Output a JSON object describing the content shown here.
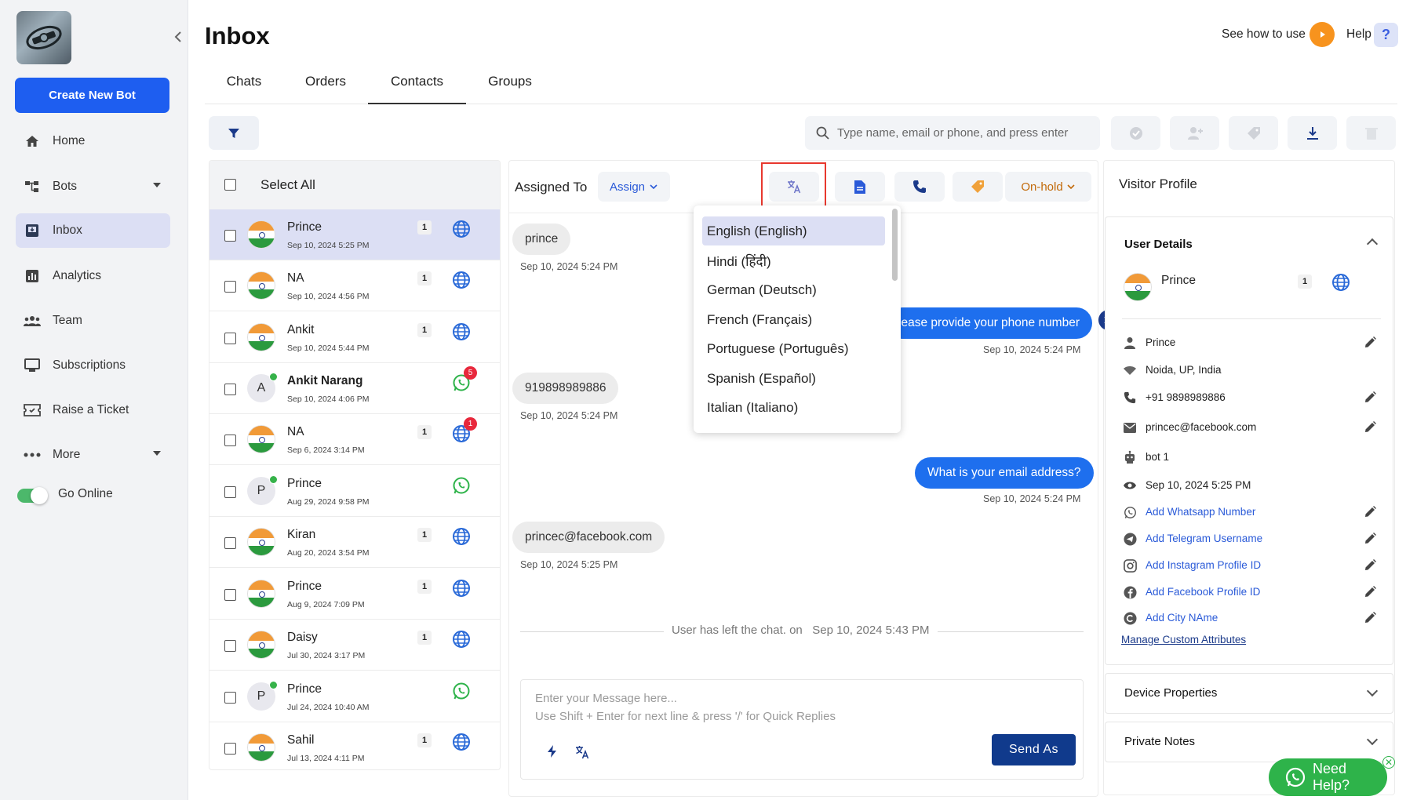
{
  "sidebar": {
    "create_button": "Create New Bot",
    "items": [
      {
        "label": "Home",
        "icon": "home-icon"
      },
      {
        "label": "Bots",
        "icon": "bots-icon"
      },
      {
        "label": "Inbox",
        "icon": "inbox-icon"
      },
      {
        "label": "Analytics",
        "icon": "analytics-icon"
      },
      {
        "label": "Team",
        "icon": "team-icon"
      },
      {
        "label": "Subscriptions",
        "icon": "subscriptions-icon"
      },
      {
        "label": "Raise a Ticket",
        "icon": "ticket-icon"
      },
      {
        "label": "More",
        "icon": "more-icon"
      }
    ],
    "go_online": "Go Online"
  },
  "header": {
    "title": "Inbox",
    "see_how": "See how to use",
    "help": "Help",
    "help_icon": "?"
  },
  "tabs": [
    "Chats",
    "Orders",
    "Contacts",
    "Groups"
  ],
  "toolbar": {
    "search_placeholder": "Type name, email or phone, and press enter"
  },
  "contact_list": {
    "select_all": "Select All",
    "contacts": [
      {
        "name": "Prince",
        "date": "Sep 10, 2024 5:25 PM",
        "count": "1",
        "channel": "web"
      },
      {
        "name": "NA",
        "date": "Sep 10, 2024 4:56 PM",
        "count": "1",
        "channel": "web"
      },
      {
        "name": "Ankit",
        "date": "Sep 10, 2024 5:44 PM",
        "count": "1",
        "channel": "web"
      },
      {
        "name": "Ankit Narang",
        "date": "Sep 10, 2024 4:06 PM",
        "initial": "A",
        "channel": "whatsapp",
        "unread": "5"
      },
      {
        "name": "NA",
        "date": "Sep 6, 2024 3:14 PM",
        "count": "1",
        "channel": "web",
        "unread": "1"
      },
      {
        "name": "Prince",
        "date": "Aug 29, 2024 9:58 PM",
        "initial": "P",
        "channel": "whatsapp"
      },
      {
        "name": "Kiran",
        "date": "Aug 20, 2024 3:54 PM",
        "count": "1",
        "channel": "web"
      },
      {
        "name": "Prince",
        "date": "Aug 9, 2024 7:09 PM",
        "count": "1",
        "channel": "web"
      },
      {
        "name": "Daisy",
        "date": "Jul 30, 2024 3:17 PM",
        "count": "1",
        "channel": "web"
      },
      {
        "name": "Prince",
        "date": "Jul 24, 2024 10:40 AM",
        "initial": "P",
        "channel": "whatsapp"
      },
      {
        "name": "Sahil",
        "date": "Jul 13, 2024 4:11 PM",
        "count": "1",
        "channel": "web"
      }
    ]
  },
  "chat": {
    "assigned_to": "Assigned To",
    "assign": "Assign",
    "status": "On-hold",
    "messages": [
      {
        "dir": "in",
        "text": "prince",
        "time": "Sep 10, 2024 5:24 PM"
      },
      {
        "dir": "out",
        "text": "Please provide your phone number",
        "time": "Sep 10, 2024 5:24 PM"
      },
      {
        "dir": "in",
        "text": "919898989886",
        "time": "Sep 10, 2024 5:24 PM"
      },
      {
        "dir": "out",
        "text": "What is your email address?",
        "time": "Sep 10, 2024 5:24 PM"
      },
      {
        "dir": "in",
        "text": "princec@facebook.com",
        "time": "Sep 10, 2024 5:25 PM"
      }
    ],
    "left_chat": "User has left the chat. on   Sep 10, 2024 5:43 PM",
    "input_placeholder": "Enter your Message here...\nUse Shift + Enter for next line & press '/' for Quick Replies",
    "send": "Send As"
  },
  "language_dropdown": {
    "options": [
      "English (English)",
      "Hindi (हिंदी)",
      "German (Deutsch)",
      "French (Français)",
      "Portuguese (Português)",
      "Spanish (Español)",
      "Italian (Italiano)"
    ],
    "selected": "English (English)"
  },
  "profile": {
    "title": "Visitor Profile",
    "user_details": "User Details",
    "name": "Prince",
    "count": "1",
    "attributes": [
      {
        "icon": "person-icon",
        "text": "Prince",
        "editable": true
      },
      {
        "icon": "location-icon",
        "text": "Noida, UP, India",
        "editable": false
      },
      {
        "icon": "phone-icon",
        "text": "+91 9898989886",
        "editable": true
      },
      {
        "icon": "mail-icon",
        "text": "princec@facebook.com",
        "editable": true
      },
      {
        "icon": "bot-icon",
        "text": "bot 1",
        "editable": false
      },
      {
        "icon": "eye-icon",
        "text": "Sep 10, 2024 5:25 PM",
        "editable": false
      },
      {
        "icon": "whatsapp-icon",
        "text": "Add Whatsapp Number",
        "editable": true,
        "link": true
      },
      {
        "icon": "telegram-icon",
        "text": "Add Telegram Username",
        "editable": true,
        "link": true
      },
      {
        "icon": "instagram-icon",
        "text": "Add Instagram Profile ID",
        "editable": true,
        "link": true
      },
      {
        "icon": "facebook-icon",
        "text": "Add Facebook Profile ID",
        "editable": true,
        "link": true
      },
      {
        "icon": "city-icon",
        "text": "Add City NAme",
        "editable": true,
        "link": true
      }
    ],
    "manage": "Manage Custom Attributes",
    "device_properties": "Device Properties",
    "private_notes": "Private Notes"
  },
  "need_help": "Need Help?",
  "colors": {
    "accent": "#1e5ef0",
    "outgoing": "#1e6fee",
    "send": "#103a8c",
    "highlight": "#e8382e"
  }
}
